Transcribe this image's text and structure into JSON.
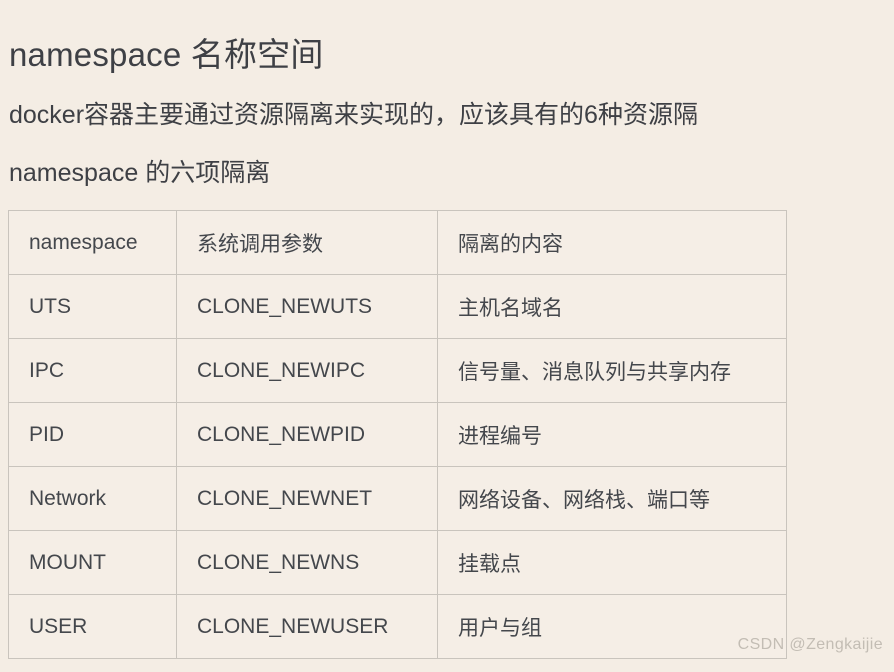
{
  "document": {
    "heading": "namespace 名称空间",
    "paragraph_lines": [
      "docker容器主要通过资源隔离来实现的，应该具有的6种资源隔",
      "namespace 的六项隔离"
    ]
  },
  "table": {
    "columns": [
      "namespace",
      "系统调用参数",
      "隔离的内容"
    ],
    "rows": [
      {
        "namespace": "UTS",
        "syscall_param": "CLONE_NEWUTS",
        "isolated_content": "主机名域名"
      },
      {
        "namespace": "IPC",
        "syscall_param": "CLONE_NEWIPC",
        "isolated_content": "信号量、消息队列与共享内存"
      },
      {
        "namespace": "PID",
        "syscall_param": "CLONE_NEWPID",
        "isolated_content": "进程编号"
      },
      {
        "namespace": "Network",
        "syscall_param": "CLONE_NEWNET",
        "isolated_content": "网络设备、网络栈、端口等"
      },
      {
        "namespace": "MOUNT",
        "syscall_param": "CLONE_NEWNS",
        "isolated_content": "挂载点"
      },
      {
        "namespace": "USER",
        "syscall_param": "CLONE_NEWUSER",
        "isolated_content": "用户与组"
      }
    ]
  },
  "watermark": {
    "text": "CSDN @Zengkaijie"
  },
  "colors": {
    "page_background": "#f4ede4",
    "table_background": "#f5eee6",
    "table_border": "#c9c4bd",
    "text": "#44474c",
    "heading_text": "#3e4045",
    "watermark_text": "#c3bdb4"
  }
}
